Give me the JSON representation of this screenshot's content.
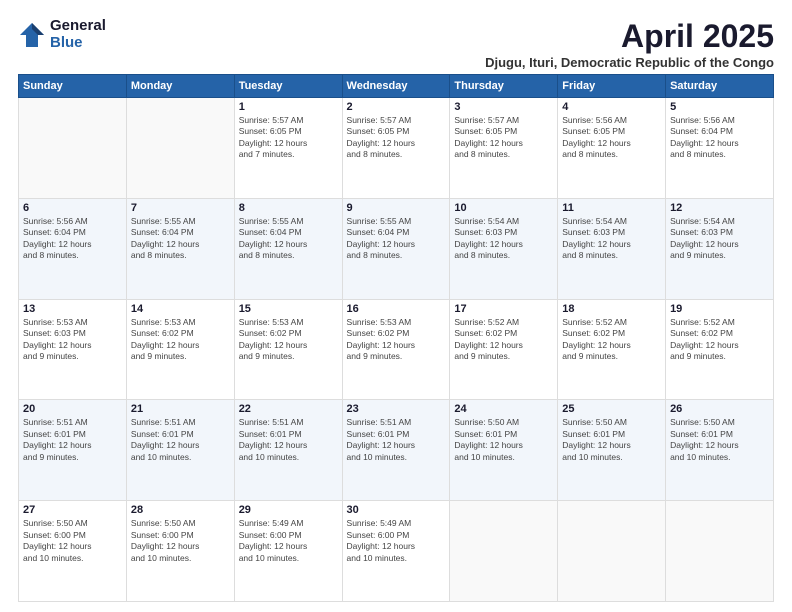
{
  "logo": {
    "general": "General",
    "blue": "Blue"
  },
  "header": {
    "month": "April 2025",
    "location": "Djugu, Ituri, Democratic Republic of the Congo"
  },
  "days_of_week": [
    "Sunday",
    "Monday",
    "Tuesday",
    "Wednesday",
    "Thursday",
    "Friday",
    "Saturday"
  ],
  "weeks": [
    [
      {
        "num": "",
        "info": ""
      },
      {
        "num": "",
        "info": ""
      },
      {
        "num": "1",
        "info": "Sunrise: 5:57 AM\nSunset: 6:05 PM\nDaylight: 12 hours\nand 7 minutes."
      },
      {
        "num": "2",
        "info": "Sunrise: 5:57 AM\nSunset: 6:05 PM\nDaylight: 12 hours\nand 8 minutes."
      },
      {
        "num": "3",
        "info": "Sunrise: 5:57 AM\nSunset: 6:05 PM\nDaylight: 12 hours\nand 8 minutes."
      },
      {
        "num": "4",
        "info": "Sunrise: 5:56 AM\nSunset: 6:05 PM\nDaylight: 12 hours\nand 8 minutes."
      },
      {
        "num": "5",
        "info": "Sunrise: 5:56 AM\nSunset: 6:04 PM\nDaylight: 12 hours\nand 8 minutes."
      }
    ],
    [
      {
        "num": "6",
        "info": "Sunrise: 5:56 AM\nSunset: 6:04 PM\nDaylight: 12 hours\nand 8 minutes."
      },
      {
        "num": "7",
        "info": "Sunrise: 5:55 AM\nSunset: 6:04 PM\nDaylight: 12 hours\nand 8 minutes."
      },
      {
        "num": "8",
        "info": "Sunrise: 5:55 AM\nSunset: 6:04 PM\nDaylight: 12 hours\nand 8 minutes."
      },
      {
        "num": "9",
        "info": "Sunrise: 5:55 AM\nSunset: 6:04 PM\nDaylight: 12 hours\nand 8 minutes."
      },
      {
        "num": "10",
        "info": "Sunrise: 5:54 AM\nSunset: 6:03 PM\nDaylight: 12 hours\nand 8 minutes."
      },
      {
        "num": "11",
        "info": "Sunrise: 5:54 AM\nSunset: 6:03 PM\nDaylight: 12 hours\nand 8 minutes."
      },
      {
        "num": "12",
        "info": "Sunrise: 5:54 AM\nSunset: 6:03 PM\nDaylight: 12 hours\nand 9 minutes."
      }
    ],
    [
      {
        "num": "13",
        "info": "Sunrise: 5:53 AM\nSunset: 6:03 PM\nDaylight: 12 hours\nand 9 minutes."
      },
      {
        "num": "14",
        "info": "Sunrise: 5:53 AM\nSunset: 6:02 PM\nDaylight: 12 hours\nand 9 minutes."
      },
      {
        "num": "15",
        "info": "Sunrise: 5:53 AM\nSunset: 6:02 PM\nDaylight: 12 hours\nand 9 minutes."
      },
      {
        "num": "16",
        "info": "Sunrise: 5:53 AM\nSunset: 6:02 PM\nDaylight: 12 hours\nand 9 minutes."
      },
      {
        "num": "17",
        "info": "Sunrise: 5:52 AM\nSunset: 6:02 PM\nDaylight: 12 hours\nand 9 minutes."
      },
      {
        "num": "18",
        "info": "Sunrise: 5:52 AM\nSunset: 6:02 PM\nDaylight: 12 hours\nand 9 minutes."
      },
      {
        "num": "19",
        "info": "Sunrise: 5:52 AM\nSunset: 6:02 PM\nDaylight: 12 hours\nand 9 minutes."
      }
    ],
    [
      {
        "num": "20",
        "info": "Sunrise: 5:51 AM\nSunset: 6:01 PM\nDaylight: 12 hours\nand 9 minutes."
      },
      {
        "num": "21",
        "info": "Sunrise: 5:51 AM\nSunset: 6:01 PM\nDaylight: 12 hours\nand 10 minutes."
      },
      {
        "num": "22",
        "info": "Sunrise: 5:51 AM\nSunset: 6:01 PM\nDaylight: 12 hours\nand 10 minutes."
      },
      {
        "num": "23",
        "info": "Sunrise: 5:51 AM\nSunset: 6:01 PM\nDaylight: 12 hours\nand 10 minutes."
      },
      {
        "num": "24",
        "info": "Sunrise: 5:50 AM\nSunset: 6:01 PM\nDaylight: 12 hours\nand 10 minutes."
      },
      {
        "num": "25",
        "info": "Sunrise: 5:50 AM\nSunset: 6:01 PM\nDaylight: 12 hours\nand 10 minutes."
      },
      {
        "num": "26",
        "info": "Sunrise: 5:50 AM\nSunset: 6:01 PM\nDaylight: 12 hours\nand 10 minutes."
      }
    ],
    [
      {
        "num": "27",
        "info": "Sunrise: 5:50 AM\nSunset: 6:00 PM\nDaylight: 12 hours\nand 10 minutes."
      },
      {
        "num": "28",
        "info": "Sunrise: 5:50 AM\nSunset: 6:00 PM\nDaylight: 12 hours\nand 10 minutes."
      },
      {
        "num": "29",
        "info": "Sunrise: 5:49 AM\nSunset: 6:00 PM\nDaylight: 12 hours\nand 10 minutes."
      },
      {
        "num": "30",
        "info": "Sunrise: 5:49 AM\nSunset: 6:00 PM\nDaylight: 12 hours\nand 10 minutes."
      },
      {
        "num": "",
        "info": ""
      },
      {
        "num": "",
        "info": ""
      },
      {
        "num": "",
        "info": ""
      }
    ]
  ]
}
